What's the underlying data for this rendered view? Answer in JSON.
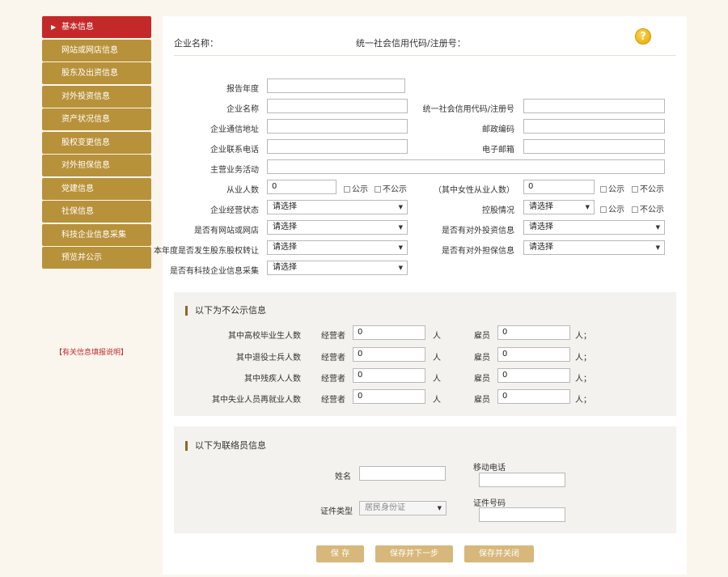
{
  "sidebar": {
    "items": [
      {
        "label": "基本信息",
        "active": true
      },
      {
        "label": "网站或网店信息"
      },
      {
        "label": "股东及出资信息"
      },
      {
        "label": "对外投资信息"
      },
      {
        "label": "资产状况信息"
      },
      {
        "label": "股权变更信息"
      },
      {
        "label": "对外担保信息"
      },
      {
        "label": "党建信息"
      },
      {
        "label": "社保信息"
      },
      {
        "label": "科技企业信息采集"
      },
      {
        "label": "预览并公示"
      }
    ],
    "help_link": "【有关信息填报说明】"
  },
  "header": {
    "company_name_label": "企业名称：",
    "credit_code_label": "统一社会信用代码/注册号：",
    "help_icon": "?"
  },
  "form": {
    "report_year_label": "报告年度",
    "company_name_label": "企业名称",
    "credit_code_label": "统一社会信用代码/注册号",
    "address_label": "企业通信地址",
    "postal_label": "邮政编码",
    "phone_label": "企业联系电话",
    "email_label": "电子邮箱",
    "business_label": "主营业务活动",
    "employees_label": "从业人数",
    "employees_value": "0",
    "female_label": "（其中女性从业人数）",
    "female_value": "0",
    "public_label": "公示",
    "nonpublic_label": "不公示",
    "status_label": "企业经营状态",
    "holding_label": "控股情况",
    "website_label": "是否有网站或网店",
    "investment_label": "是否有对外投资信息",
    "equity_transfer_label": "本年度是否发生股东股权转让",
    "guarantee_label": "是否有对外担保信息",
    "tech_label": "是否有科技企业信息采集",
    "select_placeholder": "请选择"
  },
  "nonpublic_section": {
    "title": "以下为不公示信息",
    "operator_label": "经营者",
    "employee_label": "雇员",
    "unit": "人",
    "unit_end": "人；",
    "rows": [
      {
        "label": "其中高校毕业生人数",
        "operator": "0",
        "employee": "0"
      },
      {
        "label": "其中退役士兵人数",
        "operator": "0",
        "employee": "0"
      },
      {
        "label": "其中残疾人人数",
        "operator": "0",
        "employee": "0"
      },
      {
        "label": "其中失业人员再就业人数",
        "operator": "0",
        "employee": "0"
      }
    ]
  },
  "contact_section": {
    "title": "以下为联络员信息",
    "name_label": "姓名",
    "mobile_label": "移动电话",
    "id_type_label": "证件类型",
    "id_type_value": "居民身份证",
    "id_number_label": "证件号码"
  },
  "buttons": {
    "save": "保 存",
    "save_next": "保存并下一步",
    "save_close": "保存并关闭"
  },
  "colors": {
    "sidebar_bg": "#b8923a",
    "sidebar_active": "#c4292a",
    "button_bg": "#d7b77a",
    "page_bg": "#faf6ee"
  }
}
